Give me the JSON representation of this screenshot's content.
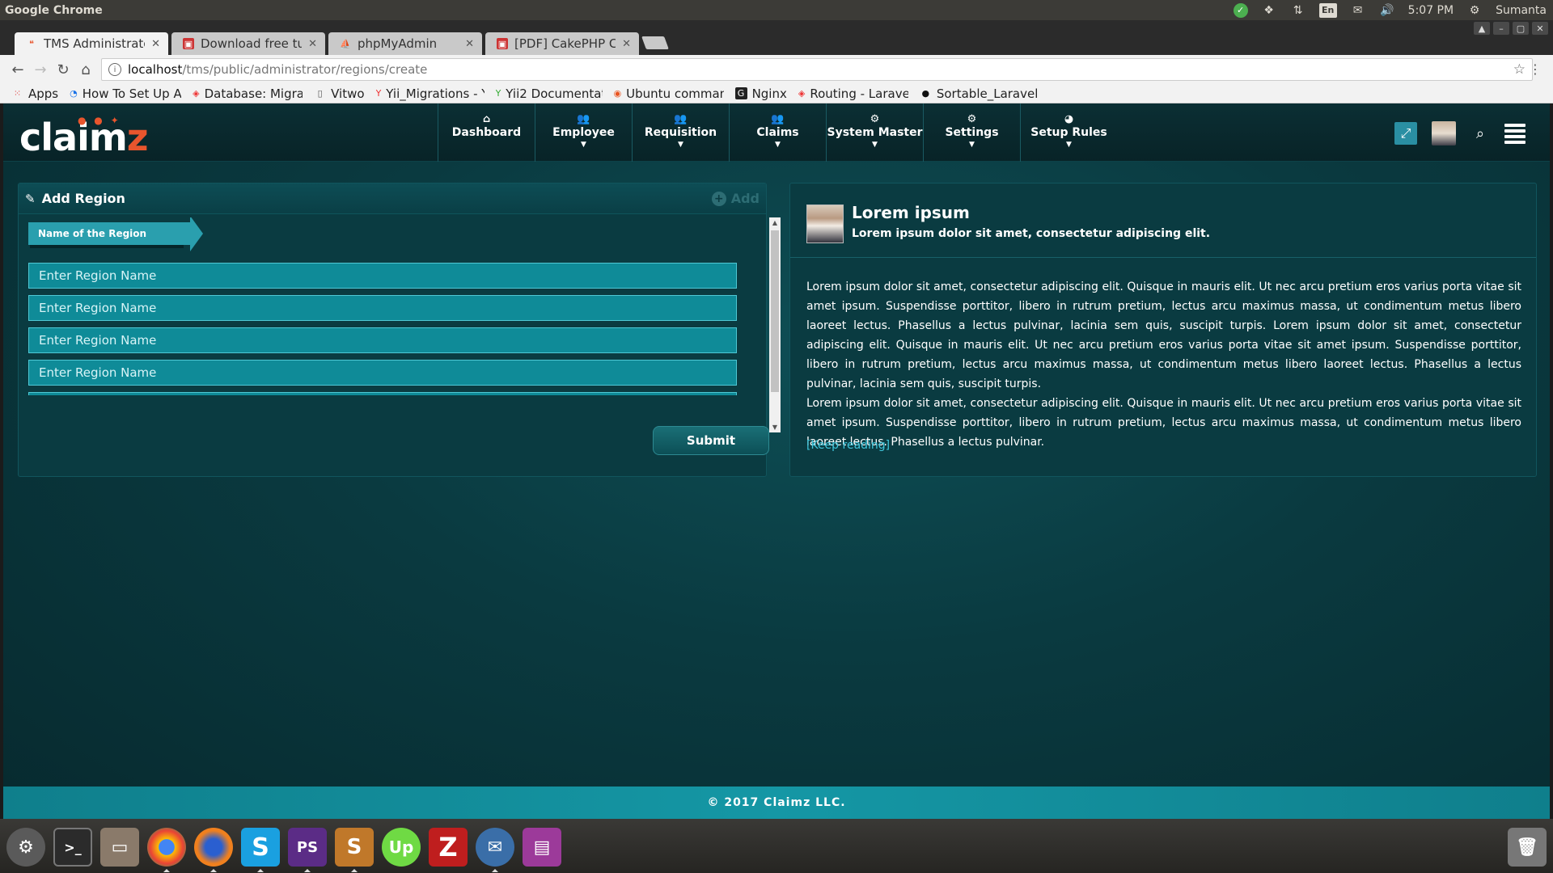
{
  "os": {
    "app_title": "Google Chrome",
    "time": "5:07 PM",
    "user": "Sumanta",
    "keyboard": "En"
  },
  "browser": {
    "tabs": [
      {
        "label": "TMS Administrator",
        "active": true
      },
      {
        "label": "Download free tut",
        "active": false
      },
      {
        "label": "phpMyAdmin",
        "active": false
      },
      {
        "label": "[PDF] CakePHP Coo",
        "active": false
      }
    ],
    "url_host": "localhost",
    "url_path": "/tms/public/administrator/regions/create",
    "bookmarks": [
      "Apps",
      "How To Set Up A",
      "Database: Migrat",
      "Vitwo",
      "Yii_Migrations - Y",
      "Yii2 Documentat",
      "Ubuntu comman",
      "Nginx",
      "Routing - Laravel",
      "Sortable_Laravel"
    ]
  },
  "app": {
    "logo": "claim",
    "logo_z": "z",
    "nav": [
      {
        "label": "Dashboard",
        "icon": "home-icon",
        "has_menu": false
      },
      {
        "label": "Employee",
        "icon": "users-icon",
        "has_menu": true
      },
      {
        "label": "Requisition",
        "icon": "users-icon",
        "has_menu": true
      },
      {
        "label": "Claims",
        "icon": "users-icon",
        "has_menu": true
      },
      {
        "label": "System Master",
        "icon": "gear-icon",
        "has_menu": true
      },
      {
        "label": "Settings",
        "icon": "gear-icon",
        "has_menu": true
      },
      {
        "label": "Setup Rules",
        "icon": "globe-icon",
        "has_menu": true
      }
    ]
  },
  "form": {
    "title": "Add Region",
    "add_label": "Add",
    "ribbon_label": "Name of the Region",
    "inputs": [
      {
        "placeholder": "Enter Region Name"
      },
      {
        "placeholder": "Enter Region Name"
      },
      {
        "placeholder": "Enter Region Name"
      },
      {
        "placeholder": "Enter Region Name"
      }
    ],
    "submit_label": "Submit"
  },
  "info": {
    "title": "Lorem ipsum",
    "subtitle": "Lorem ipsum dolor sit amet, consectetur adipiscing elit.",
    "paragraph1": "Lorem ipsum dolor sit amet, consectetur adipiscing elit. Quisque in mauris elit. Ut nec arcu pretium eros varius porta vitae sit amet ipsum. Suspendisse porttitor, libero in rutrum pretium, lectus arcu maximus massa, ut condimentum metus libero laoreet lectus. Phasellus a lectus pulvinar, lacinia sem quis, suscipit turpis. Lorem ipsum dolor sit amet, consectetur adipiscing elit. Quisque in mauris elit. Ut nec arcu pretium eros varius porta vitae sit amet ipsum. Suspendisse porttitor, libero in rutrum pretium, lectus arcu maximus massa, ut condimentum metus libero laoreet lectus. Phasellus a lectus pulvinar, lacinia sem quis, suscipit turpis.",
    "paragraph2": "Lorem ipsum dolor sit amet, consectetur adipiscing elit. Quisque in mauris elit. Ut nec arcu pretium eros varius porta vitae sit amet ipsum. Suspendisse porttitor, libero in rutrum pretium, lectus arcu maximus massa, ut condimentum metus libero laoreet lectus. Phasellus a lectus pulvinar.",
    "link": "[Keep reading]"
  },
  "footer": {
    "text": "© 2017 Claimz LLC."
  },
  "colors": {
    "accent": "#2a9fae",
    "input_bg": "#0f8b98",
    "logo_z": "#e8552d"
  }
}
